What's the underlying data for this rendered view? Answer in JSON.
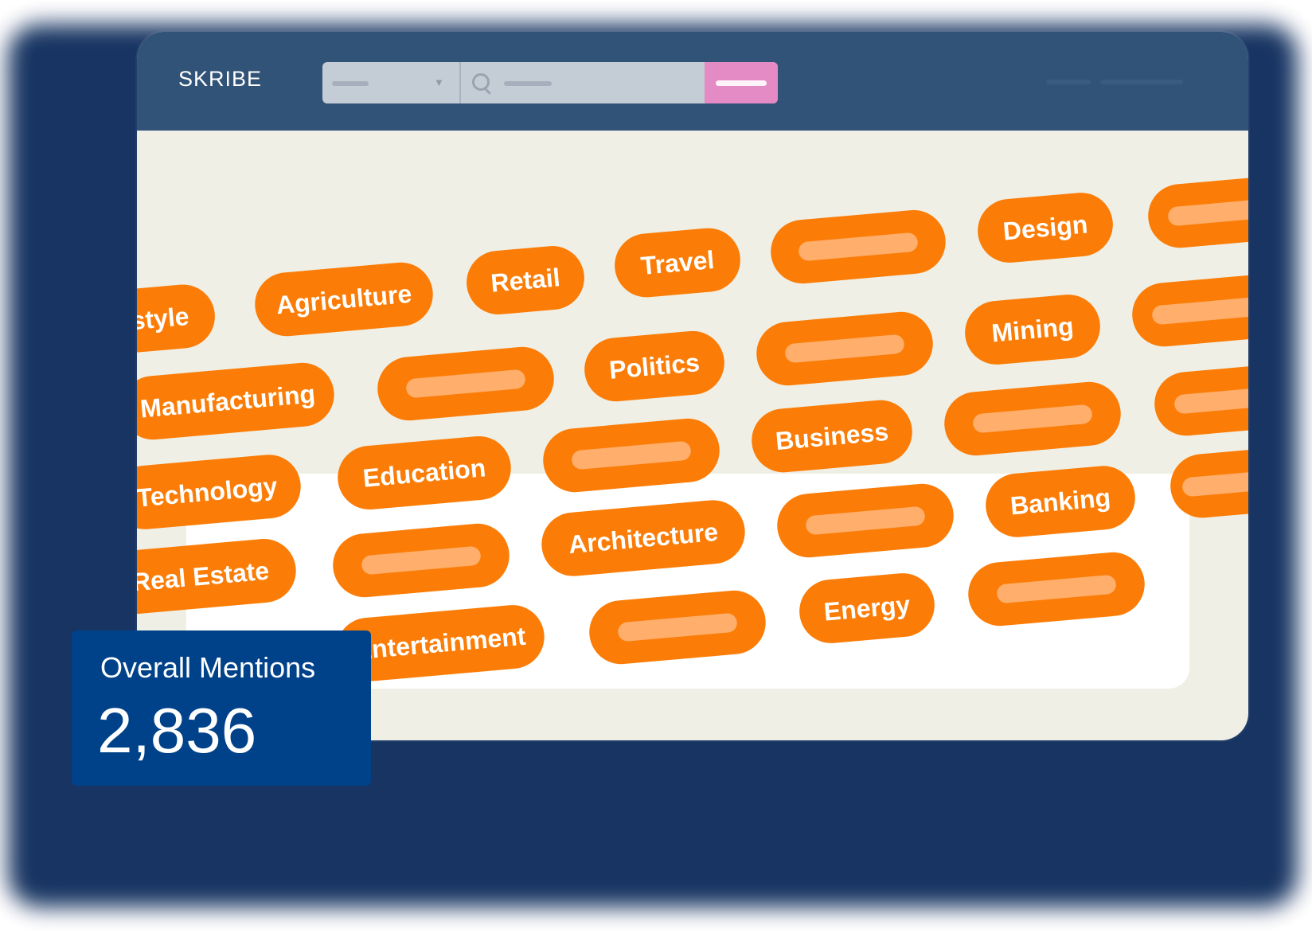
{
  "app": {
    "logo_text": "SKRIBE"
  },
  "colors": {
    "topbar": "#325378",
    "tag": "#fb7d07",
    "tag_placeholder": "#ffae6b",
    "search_button": "#e48ac4",
    "stat_card": "#00428a"
  },
  "tags": [
    "style",
    "Agriculture",
    "Retail",
    "Travel",
    "Design",
    "Manufacturing",
    "Politics",
    "Mining",
    "Technology",
    "Education",
    "Business",
    "Real Estate",
    "Architecture",
    "Banking",
    "Entertainment",
    "Energy"
  ],
  "stats": {
    "label": "Overall Mentions",
    "value": "2,836"
  }
}
